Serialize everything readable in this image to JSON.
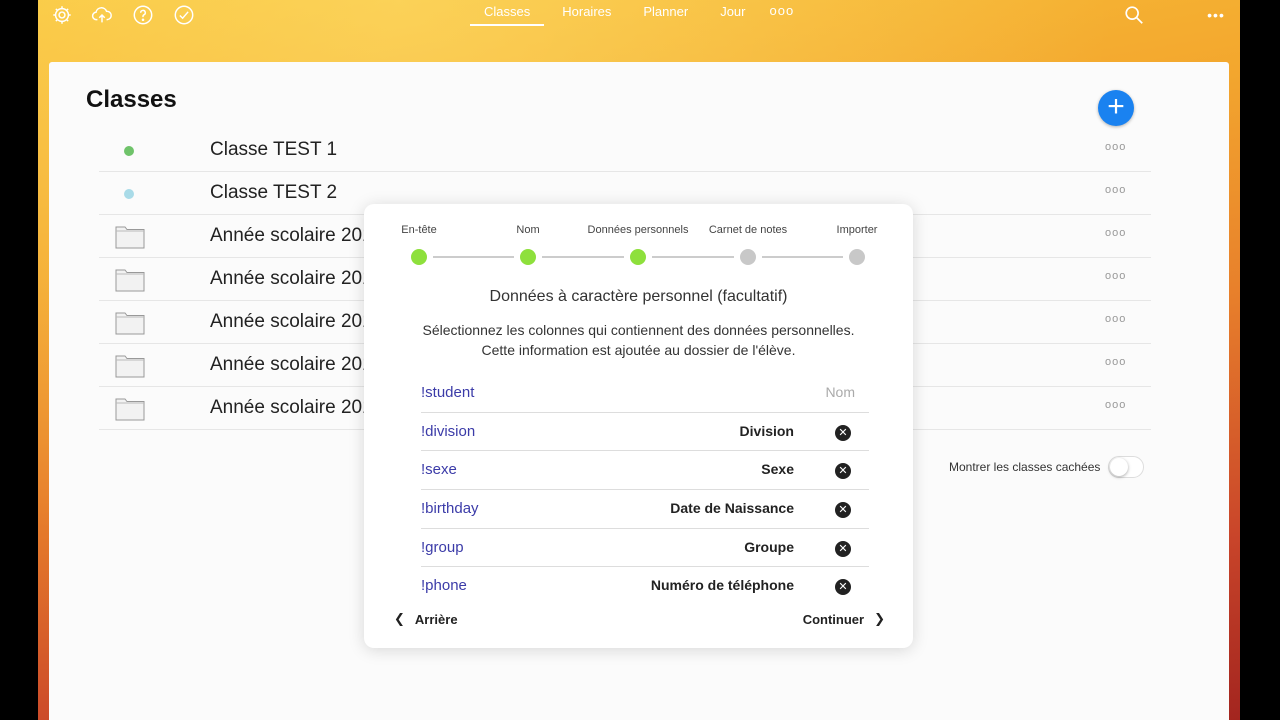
{
  "topbar": {
    "icons": [
      "gear-icon",
      "cloud-upload-icon",
      "help-icon",
      "check-circle-icon",
      "search-icon",
      "more-icon"
    ],
    "tabs": [
      {
        "label": "Classes",
        "active": true
      },
      {
        "label": "Horaires",
        "active": false
      },
      {
        "label": "Planner",
        "active": false
      },
      {
        "label": "Jour",
        "active": false
      }
    ],
    "tabs_more": "ooo",
    "right_more": "•••"
  },
  "page": {
    "title": "Classes",
    "add_label": "+",
    "rows": [
      {
        "type": "class",
        "color": "#6fc36a",
        "label": "Classe TEST 1",
        "more": "ooo"
      },
      {
        "type": "class",
        "color": "#a9dbe8",
        "label": "Classe TEST 2",
        "more": "ooo"
      },
      {
        "type": "folder",
        "label": "Année scolaire 2019-20",
        "more": "ooo"
      },
      {
        "type": "folder",
        "label": "Année scolaire 2018-20",
        "more": "ooo"
      },
      {
        "type": "folder",
        "label": "Année scolaire 2017-20",
        "more": "ooo"
      },
      {
        "type": "folder",
        "label": "Année scolaire 2016-20",
        "more": "ooo"
      },
      {
        "type": "folder",
        "label": "Année scolaire 2015-20",
        "more": "ooo"
      }
    ],
    "show_hidden_label": "Montrer les classes cachées"
  },
  "modal": {
    "steps": [
      {
        "label": "En-tête",
        "done": true
      },
      {
        "label": "Nom",
        "done": true
      },
      {
        "label": "Données personnels",
        "done": true
      },
      {
        "label": "Carnet de notes",
        "done": false
      },
      {
        "label": "Importer",
        "done": false
      }
    ],
    "colors": {
      "done": "#8ee03c",
      "pending": "#c8c8c8",
      "key_text": "#3b3ba8"
    },
    "title": "Données à caractère personnel (facultatif)",
    "desc_line1": "Sélectionnez les colonnes qui contiennent des données personnelles.",
    "desc_line2": "Cette information est ajoutée au dossier de l'élève.",
    "rows": [
      {
        "key": "!student",
        "value": "Nom",
        "removable": false
      },
      {
        "key": "!division",
        "value": "Division",
        "removable": true
      },
      {
        "key": "!sexe",
        "value": "Sexe",
        "removable": true
      },
      {
        "key": "!birthday",
        "value": "Date de Naissance",
        "removable": true
      },
      {
        "key": "!group",
        "value": "Groupe",
        "removable": true
      },
      {
        "key": "!phone",
        "value": "Numéro de téléphone",
        "removable": true
      }
    ],
    "remove_glyph": "✕",
    "back_label": "Arrière",
    "next_label": "Continuer"
  }
}
